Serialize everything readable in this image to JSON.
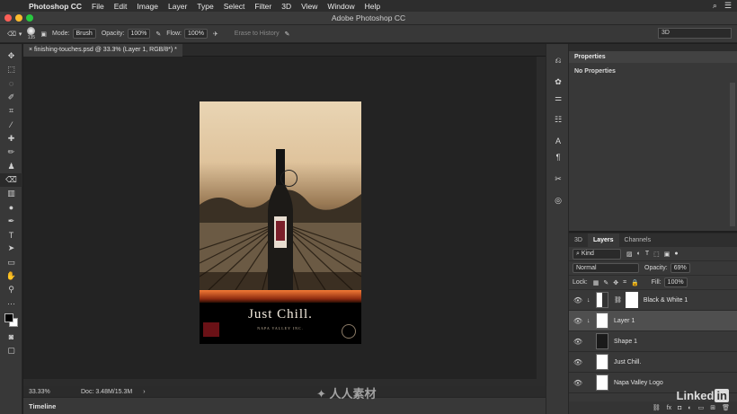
{
  "menubar": {
    "app": "Photoshop CC",
    "items": [
      "File",
      "Edit",
      "Image",
      "Layer",
      "Type",
      "Select",
      "Filter",
      "3D",
      "View",
      "Window",
      "Help"
    ]
  },
  "window": {
    "title": "Adobe Photoshop CC"
  },
  "options": {
    "brush_size": "135",
    "mode_label": "Mode:",
    "mode_value": "Brush",
    "opacity_label": "Opacity:",
    "opacity_value": "100%",
    "flow_label": "Flow:",
    "flow_value": "100%",
    "erase_history": "Erase to History",
    "workspace": "3D"
  },
  "document": {
    "tab": "finishing-touches.psd @ 33.3% (Layer 1, RGB/8*) *",
    "zoom": "33.33%",
    "doc_size": "Doc: 3.48M/15.3M"
  },
  "poster": {
    "title": "Just Chill.",
    "subtitle": "NAPA VALLEY INC."
  },
  "timeline_label": "Timeline",
  "properties": {
    "title": "Properties",
    "body": "No Properties"
  },
  "layers_panel": {
    "tabs": [
      "3D",
      "Layers",
      "Channels"
    ],
    "kind": "Kind",
    "blend": "Normal",
    "opacity_label": "Opacity:",
    "opacity_value": "69%",
    "lock_label": "Lock:",
    "fill_label": "Fill:",
    "fill_value": "100%",
    "layers": [
      {
        "name": "Black & White 1",
        "type": "adjustment",
        "selected": false
      },
      {
        "name": "Layer 1",
        "type": "pixel",
        "selected": true
      },
      {
        "name": "Shape 1",
        "type": "shape",
        "selected": false
      },
      {
        "name": "Just Chill.",
        "type": "smart",
        "selected": false
      },
      {
        "name": "Napa Valley Logo",
        "type": "smart",
        "selected": false
      }
    ]
  },
  "branding": {
    "linkedin_a": "Linked",
    "linkedin_b": "in"
  },
  "watermark": "人人素材",
  "colors": {
    "panel": "#383838",
    "canvas": "#232323",
    "selected_layer": "#4f4f4f"
  }
}
